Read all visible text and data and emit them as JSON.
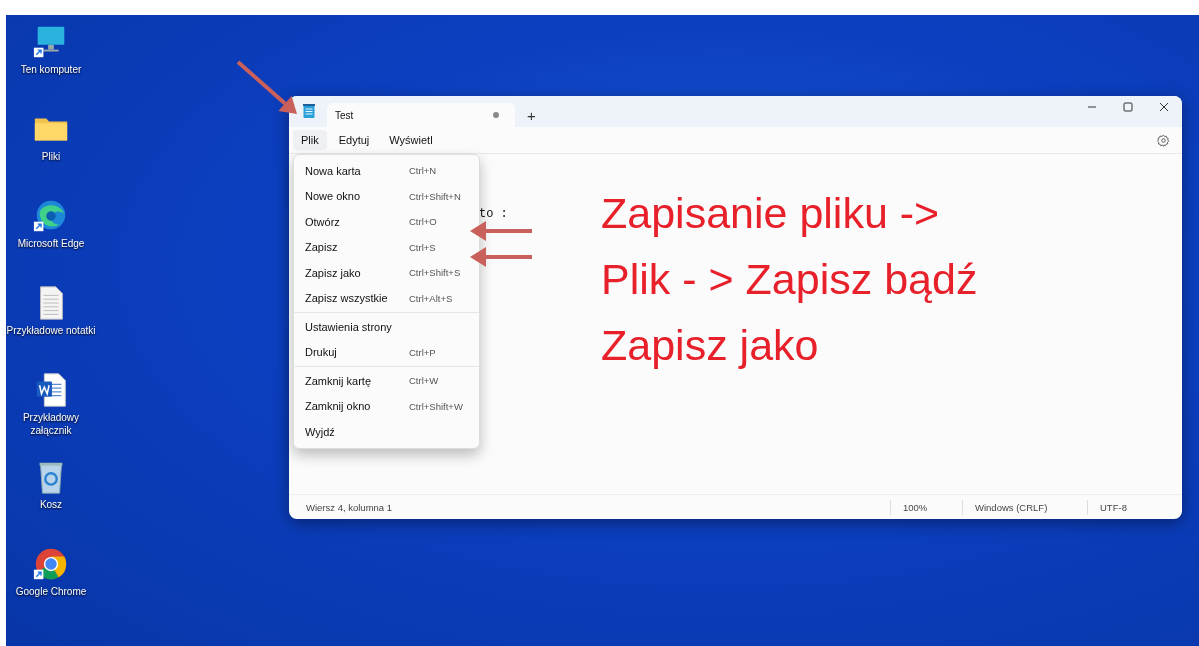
{
  "desktop_icons": [
    {
      "label": "Ten komputer",
      "kind": "computer",
      "shortcut": true
    },
    {
      "label": "Pliki",
      "kind": "folder",
      "shortcut": false
    },
    {
      "label": "Microsoft Edge",
      "kind": "edge",
      "shortcut": true
    },
    {
      "label": "Przykładowe notatki",
      "kind": "text-file",
      "shortcut": false
    },
    {
      "label": "Przykładowy załącznik",
      "kind": "word",
      "shortcut": false
    },
    {
      "label": "Kosz",
      "kind": "recycle-bin",
      "shortcut": false
    },
    {
      "label": "Google Chrome",
      "kind": "chrome",
      "shortcut": true
    }
  ],
  "window": {
    "tabs": [
      {
        "label": "Test",
        "selected": true,
        "unsaved": true
      }
    ],
    "new_tab": "+",
    "menu_bar": [
      {
        "label": "Plik",
        "selected": true
      },
      {
        "label": "Edytuj",
        "selected": false
      },
      {
        "label": "Wyświetl",
        "selected": false
      }
    ],
    "file_menu": {
      "groups": [
        [
          {
            "label": "Nowa karta",
            "shortcut": "Ctrl+N"
          },
          {
            "label": "Nowe okno",
            "shortcut": "Ctrl+Shift+N"
          },
          {
            "label": "Otwórz",
            "shortcut": "Ctrl+O"
          },
          {
            "label": "Zapisz",
            "shortcut": "Ctrl+S"
          },
          {
            "label": "Zapisz jako",
            "shortcut": "Ctrl+Shift+S"
          },
          {
            "label": "Zapisz wszystkie",
            "shortcut": "Ctrl+Alt+S"
          }
        ],
        [
          {
            "label": "Ustawienia strony"
          },
          {
            "label": "Drukuj",
            "shortcut": "Ctrl+P"
          }
        ],
        [
          {
            "label": "Zamknij kartę",
            "shortcut": "Ctrl+W"
          },
          {
            "label": "Zamknij okno",
            "shortcut": "Ctrl+Shift+W"
          },
          {
            "label": "Wyjdź"
          }
        ]
      ]
    },
    "editor_text": "to :",
    "status_bar": {
      "position": "Wiersz 4, kolumna 1",
      "zoom": "100%",
      "line_ending": "Windows (CRLF)",
      "encoding": "UTF-8"
    }
  },
  "annotation": {
    "lines": [
      "Zapisanie pliku ->",
      "Plik - > Zapisz bądź",
      "Zapisz jako"
    ]
  }
}
